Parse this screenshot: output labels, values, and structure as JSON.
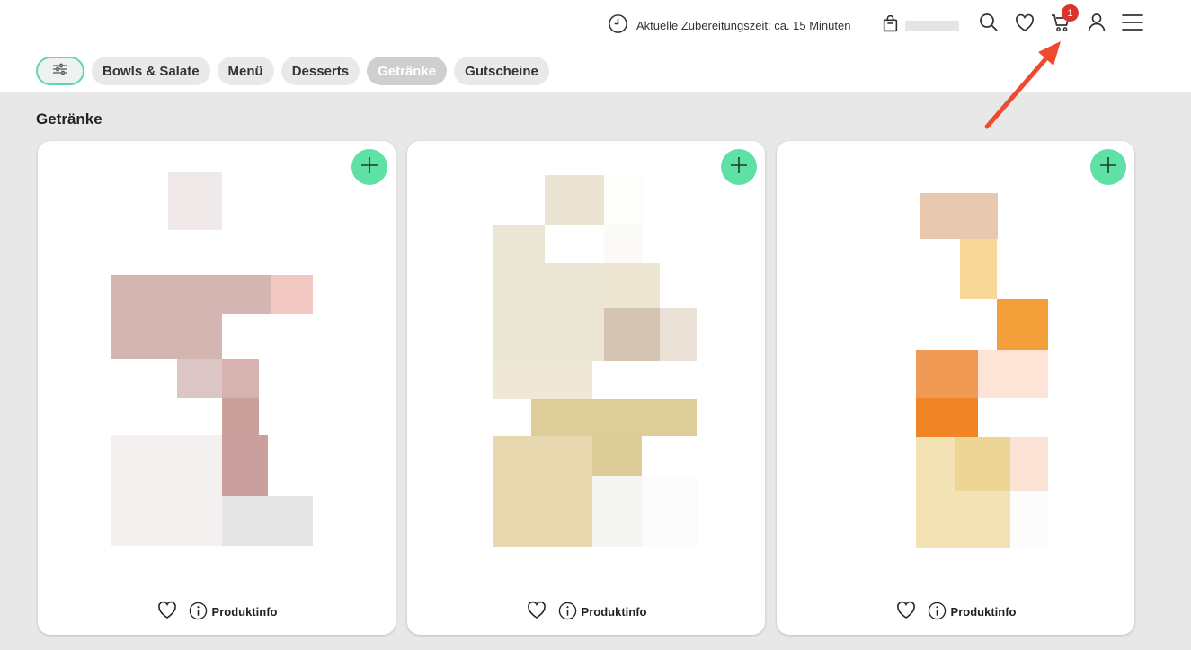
{
  "header": {
    "prep_time": "Aktuelle Zubereitungszeit: ca. 15 Minuten",
    "cart_count": "1",
    "icons": [
      "clock-icon",
      "shopping-bag-icon",
      "search-icon",
      "heart-icon",
      "cart-icon",
      "user-icon",
      "menu-icon"
    ]
  },
  "tabs": [
    {
      "label": "Bowls & Salate"
    },
    {
      "label": "Menü"
    },
    {
      "label": "Desserts"
    },
    {
      "label": "Getränke",
      "active": true
    },
    {
      "label": "Gutscheine"
    }
  ],
  "section": {
    "title": "Getränke"
  },
  "products": [
    {
      "info_label": "Produktinfo"
    },
    {
      "info_label": "Produktinfo"
    },
    {
      "info_label": "Produktinfo"
    }
  ],
  "colors": {
    "accent": "#5fe0a5",
    "badge": "#d9342b",
    "annotation_arrow": "#ee4a2e"
  }
}
